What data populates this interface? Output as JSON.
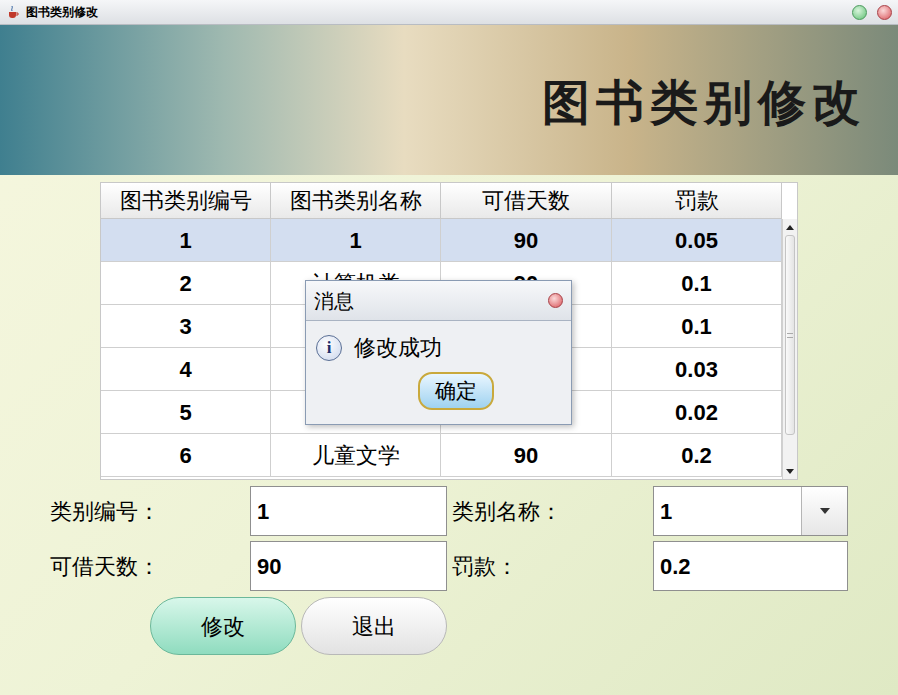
{
  "window": {
    "title": "图书类别修改"
  },
  "banner": {
    "title": "图书类别修改"
  },
  "table": {
    "columns": [
      "图书类别编号",
      "图书类别名称",
      "可借天数",
      "罚款"
    ],
    "rows": [
      {
        "cells": [
          "1",
          "1",
          "90",
          "0.05"
        ],
        "selected": true
      },
      {
        "cells": [
          "2",
          "计算机类",
          "90",
          "0.1"
        ],
        "selected": false
      },
      {
        "cells": [
          "3",
          "",
          "",
          "0.1"
        ],
        "selected": false
      },
      {
        "cells": [
          "4",
          "",
          "",
          "0.03"
        ],
        "selected": false
      },
      {
        "cells": [
          "5",
          "",
          "",
          "0.02"
        ],
        "selected": false
      },
      {
        "cells": [
          "6",
          "儿童文学",
          "90",
          "0.2"
        ],
        "selected": false
      }
    ]
  },
  "form": {
    "fields": [
      {
        "label": "类别编号：",
        "value": "1",
        "kind": "text"
      },
      {
        "label": "类别名称：",
        "value": "1",
        "kind": "combo"
      },
      {
        "label": "可借天数：",
        "value": "90",
        "kind": "text"
      },
      {
        "label": "罚款：",
        "value": "0.2",
        "kind": "text"
      }
    ]
  },
  "buttons": [
    {
      "label": "修改",
      "primary": true
    },
    {
      "label": "退出",
      "primary": false
    }
  ],
  "dialog": {
    "title": "消息",
    "icon": "i",
    "message": "修改成功",
    "button": "确定"
  }
}
